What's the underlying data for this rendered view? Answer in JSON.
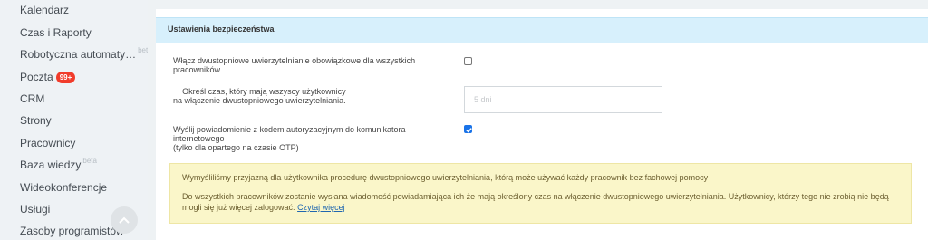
{
  "sidebar": {
    "items": [
      {
        "label": "Kalendarz"
      },
      {
        "label": "Czas i Raporty"
      },
      {
        "label": "Robotyczna automaty…",
        "beta": "beta"
      },
      {
        "label": "Poczta",
        "counter": "99+"
      },
      {
        "label": "CRM"
      },
      {
        "label": "Strony"
      },
      {
        "label": "Pracownicy"
      },
      {
        "label": "Baza wiedzy",
        "beta": "beta"
      },
      {
        "label": "Wideokonferencje"
      },
      {
        "label": "Usługi"
      },
      {
        "label": "Zasoby programistów"
      }
    ]
  },
  "section": {
    "title": "Ustawienia bezpieczeństwa",
    "fields": {
      "require_2fa": {
        "line1": "Włącz dwustopniowe uwierzytelnianie obowiązkowe dla wszystkich",
        "line2": "pracowników",
        "checked": false
      },
      "time_to_enable": {
        "line1": "Określ czas, który mają wszyscy użytkownicy",
        "line2": "na włączenie dwustopniowego uwierzytelniania.",
        "value": "5 dni"
      },
      "send_notification": {
        "line1": "Wyślij powiadomienie z kodem autoryzacyjnym do komunikatora",
        "line2": "internetowego",
        "line3": "(tylko dla opartego na czasie OTP)",
        "checked": true
      }
    },
    "notice": {
      "paragraph1": "Wymyśliliśmy przyjazną dla użytkownika procedurę dwustopniowego uwierzytelniania, którą może używać każdy pracownik bez fachowej pomocy",
      "paragraph2": "Do wszystkich pracowników zostanie wysłana wiadomość powiadamiająca ich że mają określony czas na włączenie dwustopniowego uwierzytelniania. Użytkownicy, którzy tego nie zrobią nie będą mogli się już więcej zalogować.",
      "link": "Czytaj więcej"
    }
  },
  "colors": {
    "header_bg": "#d7f0fc",
    "notice_bg": "#faf6c9",
    "counter_bg": "#f13c2b",
    "checkbox_checked": "#1a73e8",
    "link": "#2067b0"
  }
}
